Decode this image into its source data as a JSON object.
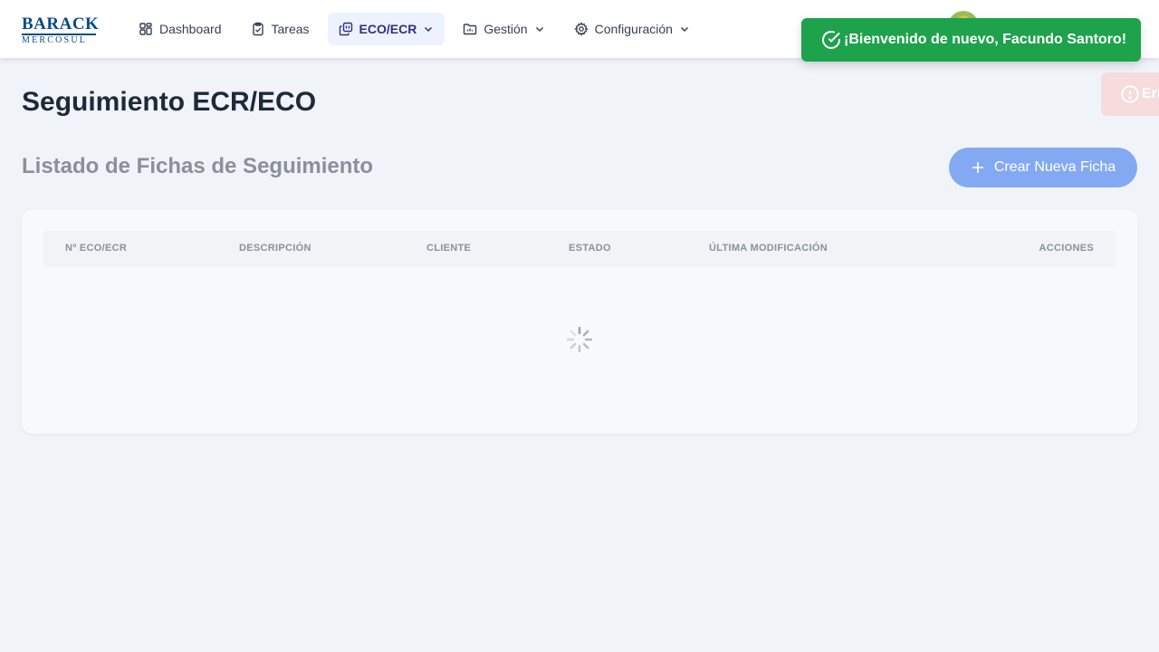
{
  "brand": {
    "name": "BARACK",
    "sub": "MERCOSUL",
    "color": "#0a4a8c"
  },
  "nav": {
    "items": [
      {
        "label": "Dashboard",
        "icon": "dashboard-icon",
        "active": false,
        "dropdown": false
      },
      {
        "label": "Tareas",
        "icon": "clipboard-check-icon",
        "active": false,
        "dropdown": false
      },
      {
        "label": "ECO/ECR",
        "icon": "copy-icon",
        "active": true,
        "dropdown": true
      },
      {
        "label": "Gestión",
        "icon": "folder-icon",
        "active": false,
        "dropdown": true
      },
      {
        "label": "Configuración",
        "icon": "gear-icon",
        "active": false,
        "dropdown": true
      }
    ]
  },
  "toasts": {
    "success": {
      "text": "¡Bienvenido de nuevo, Facundo Santoro!",
      "icon": "check-circle-icon",
      "color": "#1ea24c"
    },
    "error": {
      "text": "Err",
      "icon": "alert-circle-icon",
      "color": "#f6dcdc"
    }
  },
  "page": {
    "title": "Seguimiento ECR/ECO",
    "section_title": "Listado de Fichas de Seguimiento",
    "create_button": "Crear Nueva Ficha"
  },
  "table": {
    "columns": [
      "Nº ECO/ECR",
      "DESCRIPCIÓN",
      "CLIENTE",
      "ESTADO",
      "ÚLTIMA MODIFICACIÓN",
      "ACCIONES"
    ],
    "rows": [],
    "loading": true
  },
  "colors": {
    "accent": "#84a9f3",
    "active_nav_bg": "#eef2ff",
    "background": "#f0f3f8"
  }
}
